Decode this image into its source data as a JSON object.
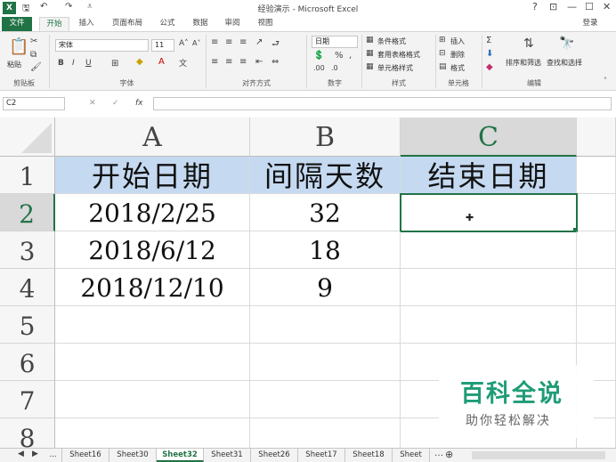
{
  "window": {
    "title": "经验演示 - Microsoft Excel",
    "app_icon": "X",
    "login": "登录",
    "controls": [
      "?",
      "⊡",
      "—",
      "☐",
      "✕"
    ]
  },
  "ribbon_tabs": [
    "文件",
    "开始",
    "插入",
    "页面布局",
    "公式",
    "数据",
    "审阅",
    "视图"
  ],
  "ribbon": {
    "clipboard": {
      "paste": "粘贴",
      "label": "剪贴板"
    },
    "font": {
      "name": "宋体",
      "size": "11",
      "label": "字体"
    },
    "alignment": {
      "label": "对齐方式"
    },
    "number": {
      "format": "日期",
      "label": "数字"
    },
    "styles": {
      "conditional": "条件格式",
      "table": "套用表格格式",
      "cell": "单元格样式",
      "label": "样式"
    },
    "cells": {
      "insert": "插入",
      "delete": "删除",
      "format": "格式",
      "label": "单元格"
    },
    "editing": {
      "sort": "排序和筛选",
      "find": "查找和选择",
      "label": "编辑"
    }
  },
  "formula_bar": {
    "name_box": "C2",
    "fx": "fx",
    "value": ""
  },
  "columns": [
    "A",
    "B",
    "C"
  ],
  "rows": [
    "1",
    "2",
    "3",
    "4",
    "5",
    "6",
    "7",
    "8"
  ],
  "table": {
    "headers": [
      "开始日期",
      "间隔天数",
      "结束日期"
    ],
    "data": [
      [
        "2018/2/25",
        "32",
        ""
      ],
      [
        "2018/6/12",
        "18",
        ""
      ],
      [
        "2018/12/10",
        "9",
        ""
      ]
    ]
  },
  "sheets": [
    "...",
    "Sheet16",
    "Sheet30",
    "Sheet32",
    "Sheet31",
    "Sheet26",
    "Sheet17",
    "Sheet18",
    "Sheet"
  ],
  "active_sheet": "Sheet32",
  "watermark": {
    "title": "百科全说",
    "subtitle": "助你轻松解决"
  },
  "colors": {
    "excel_green": "#217346",
    "header_fill": "#c5d9f1",
    "watermark_green": "#1f9c77"
  }
}
